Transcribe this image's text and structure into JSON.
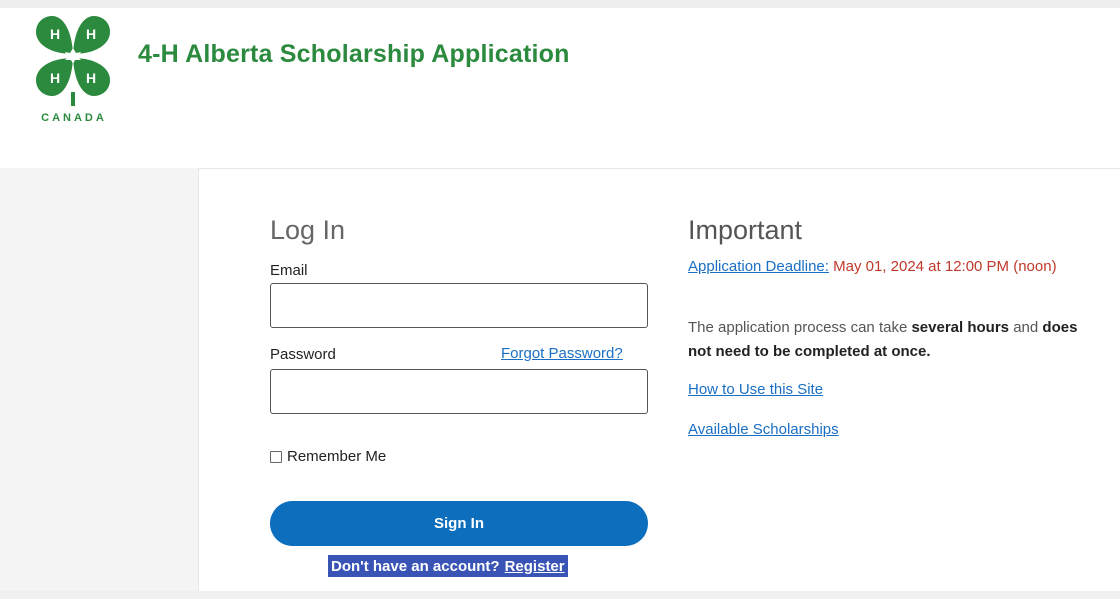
{
  "header": {
    "title": "4-H Alberta Scholarship Application",
    "logo_country": "CANADA",
    "logo_letter": "H",
    "brand_color": "#2b8a3e"
  },
  "login": {
    "heading": "Log In",
    "email_label": "Email",
    "email_value": "",
    "password_label": "Password",
    "password_value": "",
    "forgot_link": "Forgot Password?",
    "remember_label": "Remember Me",
    "remember_checked": false,
    "sign_in_label": "Sign In",
    "register_prompt": "Don't have an account?",
    "register_link": "Register",
    "button_color": "#0d6ebd"
  },
  "important": {
    "heading": "Important",
    "deadline_link": "Application Deadline:",
    "deadline_text": "May 01, 2024 at 12:00 PM (noon)",
    "process_text_1": "The application process can take",
    "process_bold_1": "several hours",
    "process_text_2": "and",
    "process_bold_2": "does not need to be completed at once.",
    "how_to_link": "How to Use this Site",
    "scholarships_link": "Available Scholarships",
    "link_color": "#1a6fc4",
    "deadline_color": "#c0392b"
  }
}
